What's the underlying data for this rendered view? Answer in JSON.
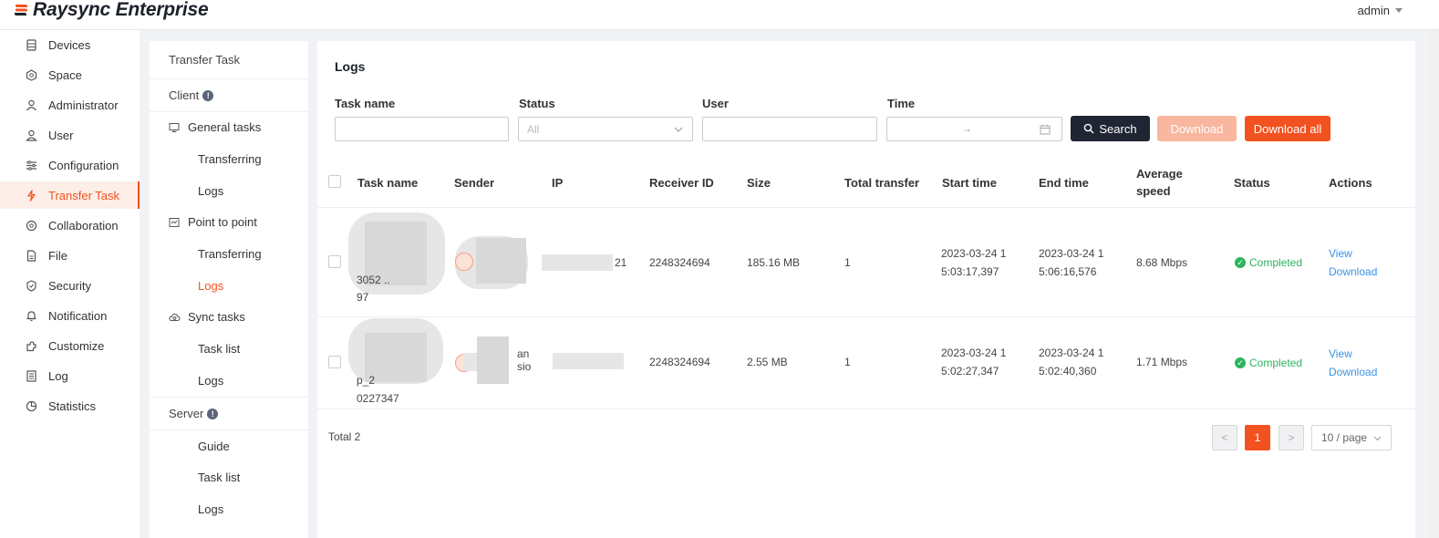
{
  "header": {
    "app_name": "Raysync Enterprise",
    "user": "admin"
  },
  "sidebar": {
    "items": [
      {
        "label": "Devices",
        "icon": "devices-icon"
      },
      {
        "label": "Space",
        "icon": "space-icon"
      },
      {
        "label": "Administrator",
        "icon": "administrator-icon"
      },
      {
        "label": "User",
        "icon": "user-icon"
      },
      {
        "label": "Configuration",
        "icon": "configuration-icon"
      },
      {
        "label": "Transfer Task",
        "icon": "transfer-task-icon",
        "active": true
      },
      {
        "label": "Collaboration",
        "icon": "collaboration-icon"
      },
      {
        "label": "File",
        "icon": "file-icon"
      },
      {
        "label": "Security",
        "icon": "security-icon"
      },
      {
        "label": "Notification",
        "icon": "notification-icon"
      },
      {
        "label": "Customize",
        "icon": "customize-icon"
      },
      {
        "label": "Log",
        "icon": "log-icon"
      },
      {
        "label": "Statistics",
        "icon": "statistics-icon"
      }
    ]
  },
  "subnav": {
    "title": "Transfer Task",
    "client": "Client",
    "general_tasks": "General tasks",
    "general_transferring": "Transferring",
    "general_logs": "Logs",
    "p2p": "Point to point",
    "p2p_transferring": "Transferring",
    "p2p_logs": "Logs",
    "sync_tasks": "Sync tasks",
    "sync_task_list": "Task list",
    "sync_logs": "Logs",
    "server": "Server",
    "server_guide": "Guide",
    "server_task_list": "Task list",
    "server_logs": "Logs"
  },
  "main": {
    "title": "Logs",
    "filters": {
      "task_name_label": "Task name",
      "status_label": "Status",
      "status_placeholder": "All",
      "user_label": "User",
      "time_label": "Time",
      "time_separator": "→"
    },
    "buttons": {
      "search": "Search",
      "download": "Download",
      "download_all": "Download all"
    },
    "columns": [
      "Task name",
      "Sender",
      "IP",
      "Receiver ID",
      "Size",
      "Total transfer",
      "Start time",
      "End time",
      "Average speed",
      "Status",
      "Actions"
    ],
    "rows": [
      {
        "task_name_tail": "3052 ..",
        "task_name_tail2": "97",
        "ip_tail": "21",
        "receiver_id": "2248324694",
        "size": "185.16 MB",
        "total_transfer": "1",
        "start_time_1": "2023-03-24 1",
        "start_time_2": "5:03:17,397",
        "end_time_1": "2023-03-24 1",
        "end_time_2": "5:06:16,576",
        "average_speed": "8.68 Mbps",
        "status": "Completed",
        "action_view": "View",
        "action_download": "Download"
      },
      {
        "task_name_tail": "p_2",
        "task_name_tail2": "0227347",
        "sender_tail_1": "an",
        "sender_tail_2": "sio",
        "receiver_id": "2248324694",
        "size": "2.55 MB",
        "total_transfer": "1",
        "start_time_1": "2023-03-24 1",
        "start_time_2": "5:02:27,347",
        "end_time_1": "2023-03-24 1",
        "end_time_2": "5:02:40,360",
        "average_speed": "1.71 Mbps",
        "status": "Completed",
        "action_view": "View",
        "action_download": "Download"
      }
    ],
    "pagination": {
      "total": "Total 2",
      "prev": "<",
      "page": "1",
      "next": ">",
      "page_size": "10 / page"
    }
  },
  "colors": {
    "accent": "#f2521f",
    "download_disabled": "#f9b79f",
    "search_button": "#1f2533",
    "completed": "#2db45d",
    "link": "#3a93e6"
  }
}
